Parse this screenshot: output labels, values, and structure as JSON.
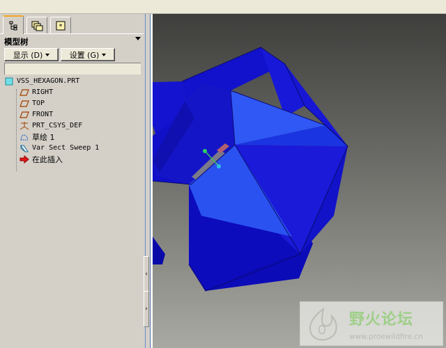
{
  "navigator": {
    "title": "模型树",
    "show_button": "显示 (D)",
    "settings_button": "设置 (G)",
    "tabs": [
      {
        "icon": "model-tree-icon",
        "active": true
      },
      {
        "icon": "folder-browser-icon",
        "active": false
      },
      {
        "icon": "favorites-icon",
        "active": false
      }
    ]
  },
  "tree": {
    "items": [
      {
        "label": "VSS_HEXAGON.PRT",
        "icon": "part-icon"
      },
      {
        "label": "RIGHT",
        "icon": "datum-plane-icon"
      },
      {
        "label": "TOP",
        "icon": "datum-plane-icon"
      },
      {
        "label": "FRONT",
        "icon": "datum-plane-icon"
      },
      {
        "label": "PRT_CSYS_DEF",
        "icon": "coordinate-system-icon"
      },
      {
        "label": "草绘 1",
        "icon": "sketch-icon"
      },
      {
        "label": "Var Sect Sweep 1",
        "icon": "sweep-feature-icon"
      },
      {
        "label": "在此插入",
        "icon": "insert-here-arrow-icon"
      }
    ]
  },
  "watermark": {
    "title": "野火论坛",
    "url": "www.proewildfire.cn"
  },
  "colors": {
    "model_blue": "#1010d8",
    "model_light": "#2f58f4",
    "active_tab": "#f5a623"
  }
}
